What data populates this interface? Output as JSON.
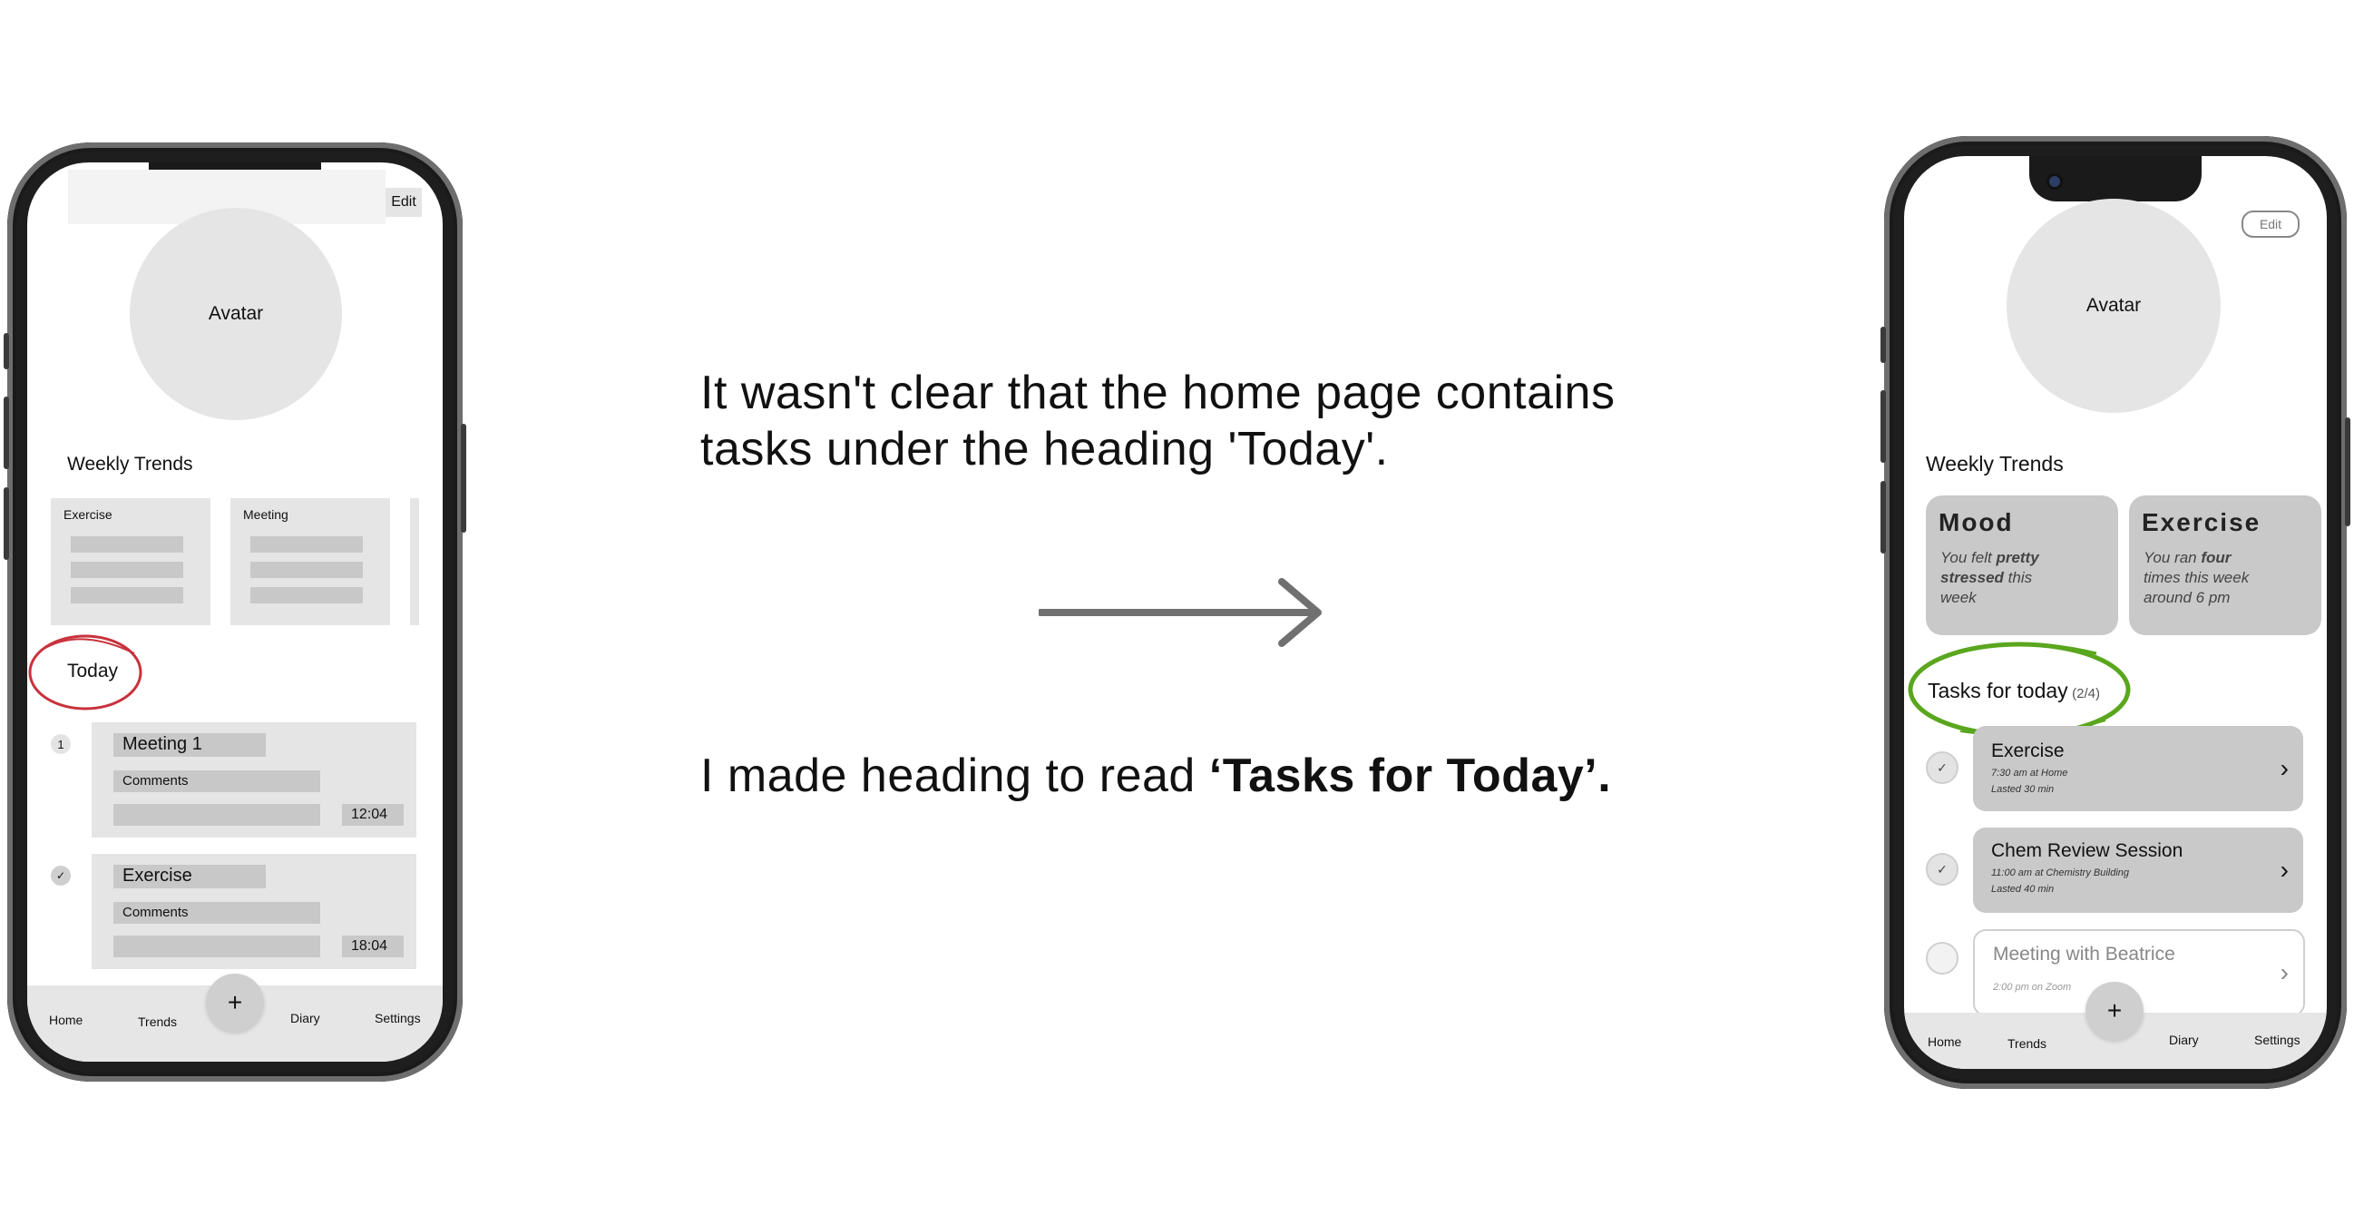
{
  "left_phone": {
    "edit_label": "Edit",
    "avatar_label": "Avatar",
    "weekly_trends_label": "Weekly Trends",
    "trend_cards": [
      "Exercise",
      "Meeting"
    ],
    "today_label": "Today",
    "tasks": [
      {
        "marker": "1",
        "title": "Meeting 1",
        "comments": "Comments",
        "time": "12:04"
      },
      {
        "marker": "",
        "title": "Exercise",
        "comments": "Comments",
        "time": "18:04"
      }
    ],
    "nav": {
      "home": "Home",
      "trends": "Trends",
      "add": "+",
      "diary": "Diary",
      "settings": "Settings"
    }
  },
  "notes": {
    "problem_line1": "It wasn't clear that the home page contains",
    "problem_line2": "tasks under the heading 'Today'.",
    "fix_prefix": "I made heading to read ",
    "fix_bold": "‘Tasks for Today’."
  },
  "right_phone": {
    "edit_label": "Edit",
    "avatar_label": "Avatar",
    "weekly_trends_label": "Weekly Trends",
    "trend_cards": [
      {
        "title": "Mood",
        "line1_pre": "You felt ",
        "line1_bold": "pretty",
        "line2_bold": "stressed",
        "line2_post": " this",
        "line3": "week"
      },
      {
        "title": "Exercise",
        "line1_pre": "You ran ",
        "line1_bold": "four",
        "line2": "times this week",
        "line3": "around 6 pm"
      }
    ],
    "tasks_heading": "Tasks for today",
    "tasks_count": "(2/4)",
    "tasks": [
      {
        "title": "Exercise",
        "sub1": "7:30 am at Home",
        "sub2": "Lasted 30 min",
        "done": true
      },
      {
        "title": "Chem Review Session",
        "sub1": "11:00 am at Chemistry Building",
        "sub2": "Lasted 40 min",
        "done": true
      },
      {
        "title": "Meeting with Beatrice",
        "sub1": "2:00 pm on Zoom",
        "sub2": "",
        "done": false
      }
    ],
    "nav": {
      "home": "Home",
      "trends": "Trends",
      "add": "+",
      "diary": "Diary",
      "settings": "Settings"
    }
  },
  "colors": {
    "left_highlight": "#c8323c",
    "right_highlight": "#5aa61e",
    "arrow": "#707070"
  }
}
